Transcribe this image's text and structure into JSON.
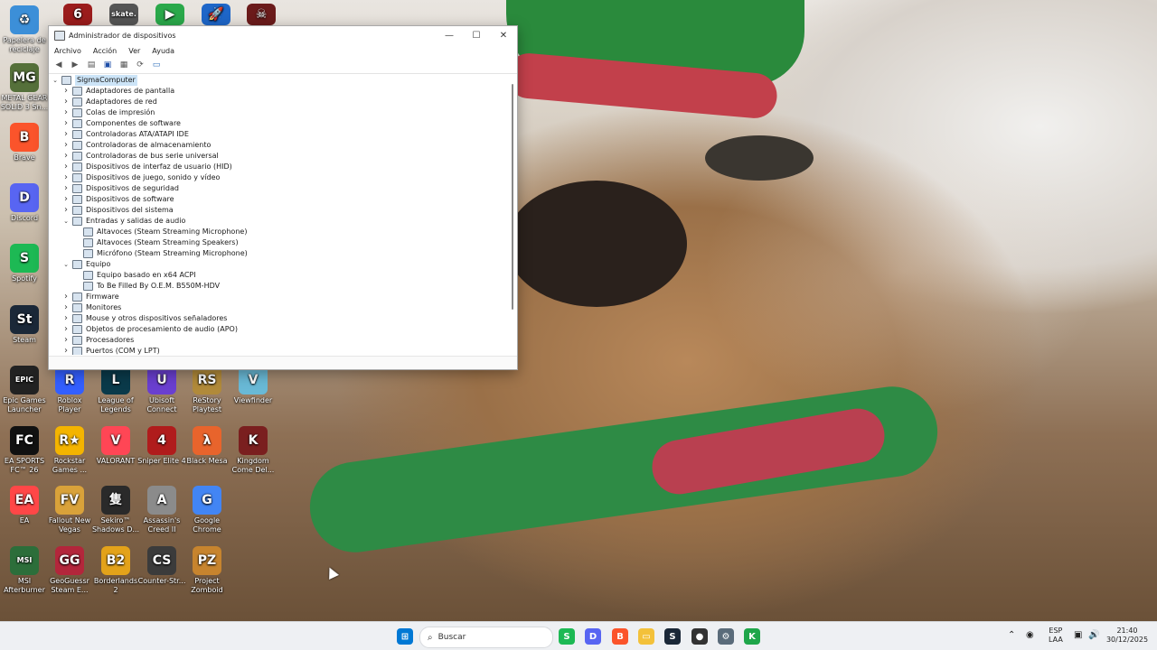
{
  "window": {
    "title": "Administrador de dispositivos",
    "controls": {
      "minimize": "—",
      "maximize": "☐",
      "close": "✕"
    },
    "menu": [
      "Archivo",
      "Acción",
      "Ver",
      "Ayuda"
    ],
    "tree": [
      {
        "label": "SigmaComputer",
        "level": 0,
        "expand": "v"
      },
      {
        "label": "Adaptadores de pantalla",
        "level": 1,
        "expand": ">"
      },
      {
        "label": "Adaptadores de red",
        "level": 1,
        "expand": ">"
      },
      {
        "label": "Colas de impresión",
        "level": 1,
        "expand": ">"
      },
      {
        "label": "Componentes de software",
        "level": 1,
        "expand": ">"
      },
      {
        "label": "Controladoras ATA/ATAPI IDE",
        "level": 1,
        "expand": ">"
      },
      {
        "label": "Controladoras de almacenamiento",
        "level": 1,
        "expand": ">"
      },
      {
        "label": "Controladoras de bus serie universal",
        "level": 1,
        "expand": ">"
      },
      {
        "label": "Dispositivos de interfaz de usuario (HID)",
        "level": 1,
        "expand": ">"
      },
      {
        "label": "Dispositivos de juego, sonido y vídeo",
        "level": 1,
        "expand": ">"
      },
      {
        "label": "Dispositivos de seguridad",
        "level": 1,
        "expand": ">"
      },
      {
        "label": "Dispositivos de software",
        "level": 1,
        "expand": ">"
      },
      {
        "label": "Dispositivos del sistema",
        "level": 1,
        "expand": ">"
      },
      {
        "label": "Entradas y salidas de audio",
        "level": 1,
        "expand": "v"
      },
      {
        "label": "Altavoces (Steam Streaming Microphone)",
        "level": 2,
        "expand": ""
      },
      {
        "label": "Altavoces (Steam Streaming Speakers)",
        "level": 2,
        "expand": ""
      },
      {
        "label": "Micrófono (Steam Streaming Microphone)",
        "level": 2,
        "expand": ""
      },
      {
        "label": "Equipo",
        "level": 1,
        "expand": "v"
      },
      {
        "label": "Equipo basado en x64 ACPI",
        "level": 2,
        "expand": ""
      },
      {
        "label": "To Be Filled By O.E.M. B550M-HDV",
        "level": 2,
        "expand": ""
      },
      {
        "label": "Firmware",
        "level": 1,
        "expand": ">"
      },
      {
        "label": "Monitores",
        "level": 1,
        "expand": ">"
      },
      {
        "label": "Mouse y otros dispositivos señaladores",
        "level": 1,
        "expand": ">"
      },
      {
        "label": "Objetos de procesamiento de audio (APO)",
        "level": 1,
        "expand": ">"
      },
      {
        "label": "Procesadores",
        "level": 1,
        "expand": ">"
      },
      {
        "label": "Puertos (COM y LPT)",
        "level": 1,
        "expand": ">"
      }
    ]
  },
  "desktop_icons": [
    {
      "label": "Papelera de reciclaje",
      "color": "#3c8fd8",
      "glyph": "♻",
      "col": 0,
      "row": 0
    },
    {
      "label": "METAL GEAR SOLID 3 Sn...",
      "color": "#55703a",
      "glyph": "MG",
      "col": 0,
      "row": 1
    },
    {
      "label": "Brave",
      "color": "#fb542b",
      "glyph": "B",
      "col": 0,
      "row": 2
    },
    {
      "label": "Discord",
      "color": "#5865f2",
      "glyph": "D",
      "col": 0,
      "row": 3
    },
    {
      "label": "Spotify",
      "color": "#1db954",
      "glyph": "S",
      "col": 0,
      "row": 4
    },
    {
      "label": "Steam",
      "color": "#1b2838",
      "glyph": "St",
      "col": 0,
      "row": 5
    },
    {
      "label": "Epic Games Launcher",
      "color": "#222222",
      "glyph": "EPIC",
      "col": 0,
      "row": 6
    },
    {
      "label": "EA SPORTS FC™ 26",
      "color": "#111111",
      "glyph": "FC",
      "col": 0,
      "row": 7
    },
    {
      "label": "EA",
      "color": "#ff4747",
      "glyph": "EA",
      "col": 0,
      "row": 8
    },
    {
      "label": "MSI Afterburner",
      "color": "#2c6e3a",
      "glyph": "MSI",
      "col": 0,
      "row": 9
    },
    {
      "label": "Roblox Player",
      "color": "#335fff",
      "glyph": "R",
      "col": 1,
      "row": 6
    },
    {
      "label": "League of Legends",
      "color": "#0a3a4a",
      "glyph": "L",
      "col": 2,
      "row": 6
    },
    {
      "label": "Ubisoft Connect",
      "color": "#6a3fd0",
      "glyph": "U",
      "col": 3,
      "row": 6
    },
    {
      "label": "ReStory Playtest",
      "color": "#b18a3a",
      "glyph": "RS",
      "col": 4,
      "row": 6
    },
    {
      "label": "Viewfinder",
      "color": "#69b9d6",
      "glyph": "V",
      "col": 5,
      "row": 6
    },
    {
      "label": "Rockstar Games ...",
      "color": "#f4b400",
      "glyph": "R★",
      "col": 1,
      "row": 7
    },
    {
      "label": "VALORANT",
      "color": "#ff4655",
      "glyph": "V",
      "col": 2,
      "row": 7
    },
    {
      "label": "Sniper Elite 4",
      "color": "#b01c1c",
      "glyph": "4",
      "col": 3,
      "row": 7
    },
    {
      "label": "Black Mesa",
      "color": "#e8642c",
      "glyph": "λ",
      "col": 4,
      "row": 7
    },
    {
      "label": "Kingdom Come Del...",
      "color": "#7a1f1f",
      "glyph": "K",
      "col": 5,
      "row": 7
    },
    {
      "label": "Fallout New Vegas",
      "color": "#d9a23a",
      "glyph": "FV",
      "col": 1,
      "row": 8
    },
    {
      "label": "Sekiro™ Shadows D...",
      "color": "#2a2a2a",
      "glyph": "隻",
      "col": 2,
      "row": 8
    },
    {
      "label": "Assassin's Creed II",
      "color": "#8b8b8b",
      "glyph": "A",
      "col": 3,
      "row": 8
    },
    {
      "label": "Google Chrome",
      "color": "#4285f4",
      "glyph": "G",
      "col": 4,
      "row": 8
    },
    {
      "label": "GeoGuessr Steam E...",
      "color": "#b3263b",
      "glyph": "GG",
      "col": 1,
      "row": 9
    },
    {
      "label": "Borderlands 2",
      "color": "#e3a21a",
      "glyph": "B2",
      "col": 2,
      "row": 9
    },
    {
      "label": "Counter-Str...",
      "color": "#3b3b3b",
      "glyph": "CS",
      "col": 3,
      "row": 9
    },
    {
      "label": "Project Zomboid",
      "color": "#c7842e",
      "glyph": "PZ",
      "col": 4,
      "row": 9
    }
  ],
  "top_icons": [
    {
      "label": "",
      "color": "#9b1c1c",
      "glyph": "6"
    },
    {
      "label": "",
      "color": "#555555",
      "glyph": "skate."
    },
    {
      "label": "",
      "color": "#2aa84a",
      "glyph": "▶"
    },
    {
      "label": "",
      "color": "#1e66c8",
      "glyph": "🚀"
    },
    {
      "label": "",
      "color": "#6b1b1b",
      "glyph": "☠"
    }
  ],
  "taskbar": {
    "search_placeholder": "Buscar",
    "lang_line1": "ESP",
    "lang_line2": "LAA",
    "time": "21:40",
    "date": "30/12/2025",
    "apps": [
      {
        "name": "start",
        "color": "#0078d4",
        "glyph": "⊞"
      },
      {
        "name": "spotify",
        "color": "#1db954",
        "glyph": "S"
      },
      {
        "name": "discord",
        "color": "#5865f2",
        "glyph": "D"
      },
      {
        "name": "brave",
        "color": "#fb542b",
        "glyph": "B"
      },
      {
        "name": "explorer",
        "color": "#f3c13a",
        "glyph": "▭"
      },
      {
        "name": "steam",
        "color": "#1b2838",
        "glyph": "S"
      },
      {
        "name": "obs",
        "color": "#333333",
        "glyph": "●"
      },
      {
        "name": "device-manager",
        "color": "#5a6b7a",
        "glyph": "⚙"
      },
      {
        "name": "app-green",
        "color": "#1fa64a",
        "glyph": "K"
      }
    ]
  }
}
